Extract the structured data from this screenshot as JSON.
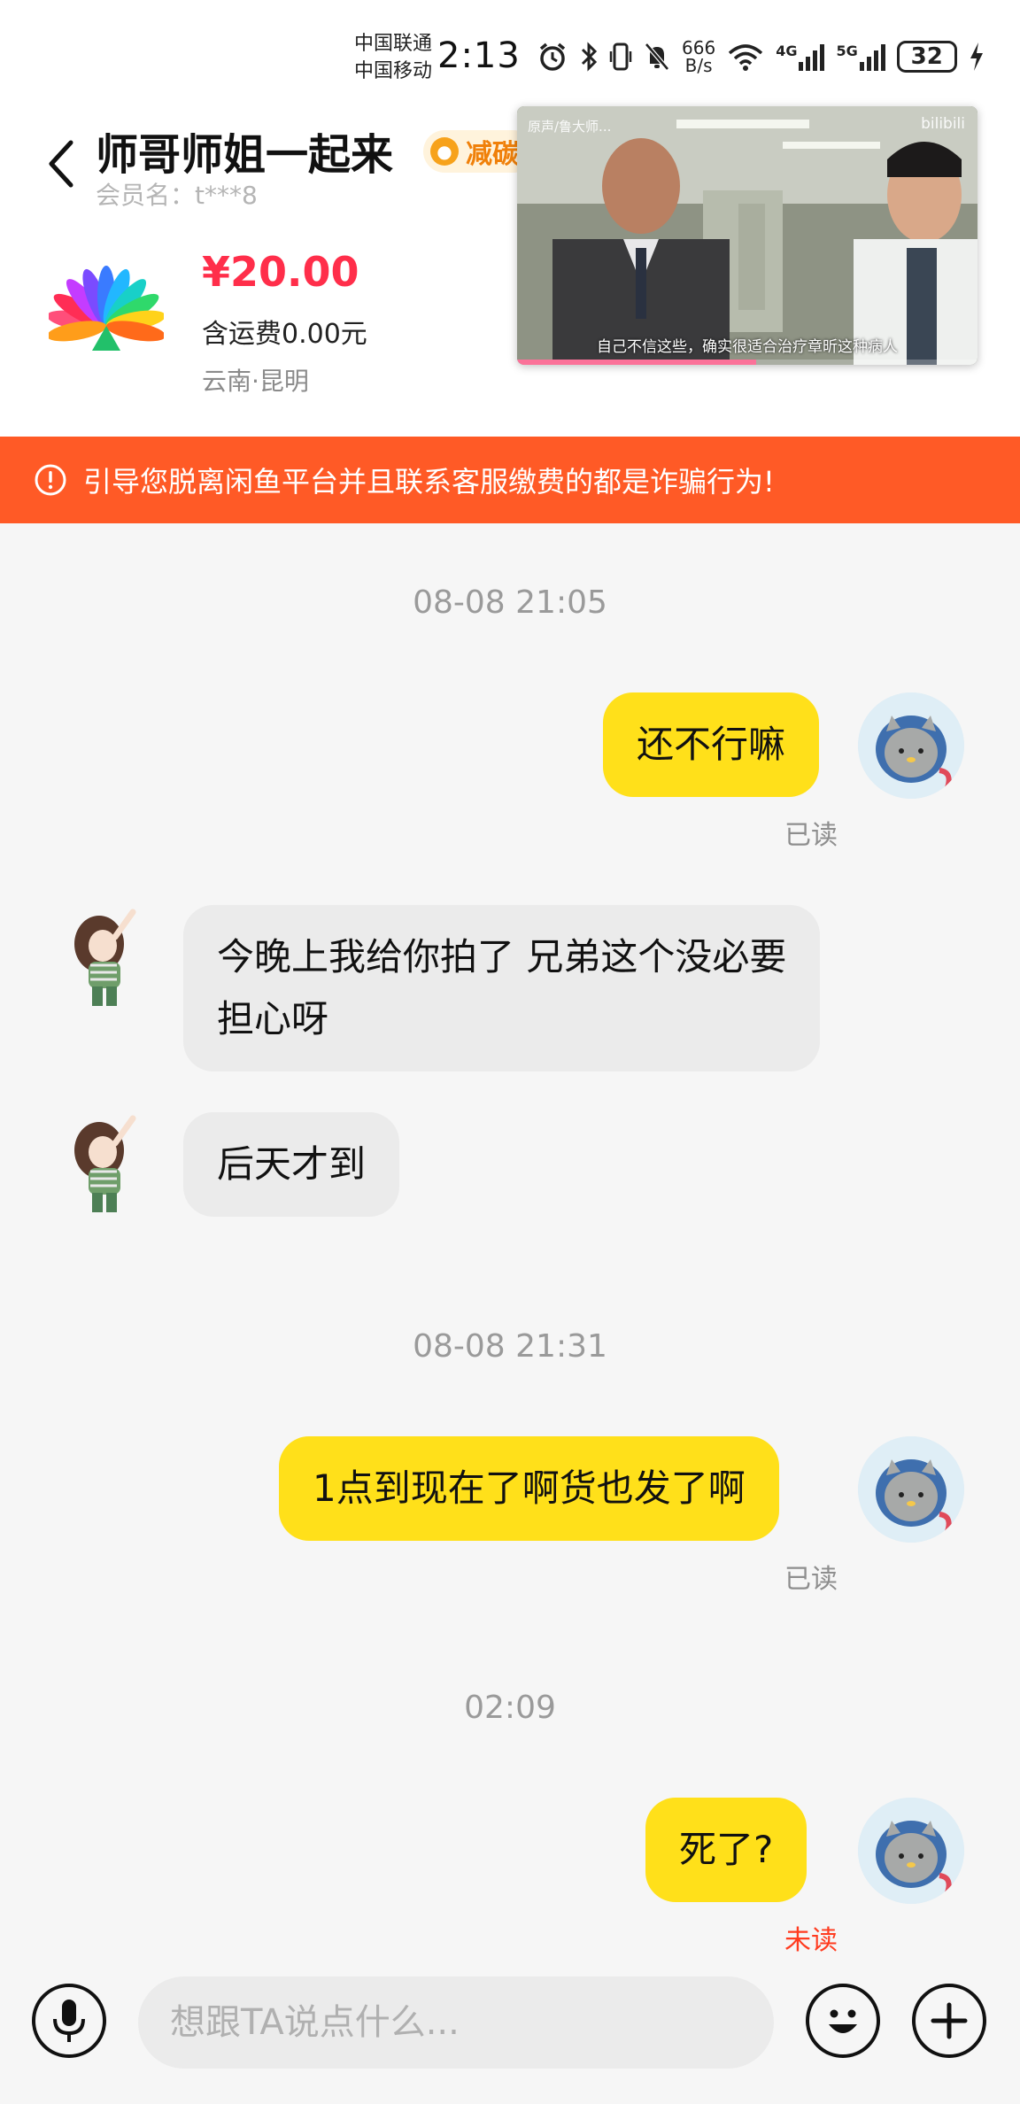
{
  "status_bar": {
    "carrier_1": "中国联通",
    "carrier_2": "中国移动",
    "time": "2:13",
    "net_speed_value": "666",
    "net_speed_unit": "B/s",
    "signal_1_label": "4G",
    "signal_2_label": "5G",
    "battery": "32",
    "icons": [
      "alarm-icon",
      "bluetooth-icon",
      "vibrate-icon",
      "mute-icon",
      "wifi-icon",
      "signal-icon",
      "charging-icon"
    ]
  },
  "header": {
    "seller_name": "师哥师姐一起来",
    "carbon_tag": "减碳",
    "member_name": "会员名：t***8",
    "price": "¥20.00",
    "shipping": "含运费0.00元",
    "location": "云南·昆明"
  },
  "video": {
    "top_text": "原声/鲁大师...",
    "brand": "bilibili",
    "subtitle": "自己不信这些，确实很适合治疗章昕这种病人",
    "progress": 0.52
  },
  "warning": {
    "text": "引导您脱离闲鱼平台并且联系客服缴费的都是诈骗行为!"
  },
  "chat": {
    "timestamp_1": "08-08 21:05",
    "msg_1": "还不行嘛",
    "msg_1_status": "已读",
    "msg_2_line1": "今晚上我给你拍了 兄弟这个没必要",
    "msg_2_line2": "担心呀",
    "msg_3": "后天才到",
    "timestamp_2": "08-08 21:31",
    "msg_4": "1点到现在了啊货也发了啊",
    "msg_4_status": "已读",
    "timestamp_3": "02:09",
    "msg_5": "死了?",
    "msg_5_status": "未读"
  },
  "input": {
    "placeholder": "想跟TA说点什么..."
  },
  "colors": {
    "accent_yellow": "#ffe01a",
    "warning_orange": "#ff5a26",
    "price_red": "#ff2e4a",
    "unread_red": "#ff3b1f"
  }
}
